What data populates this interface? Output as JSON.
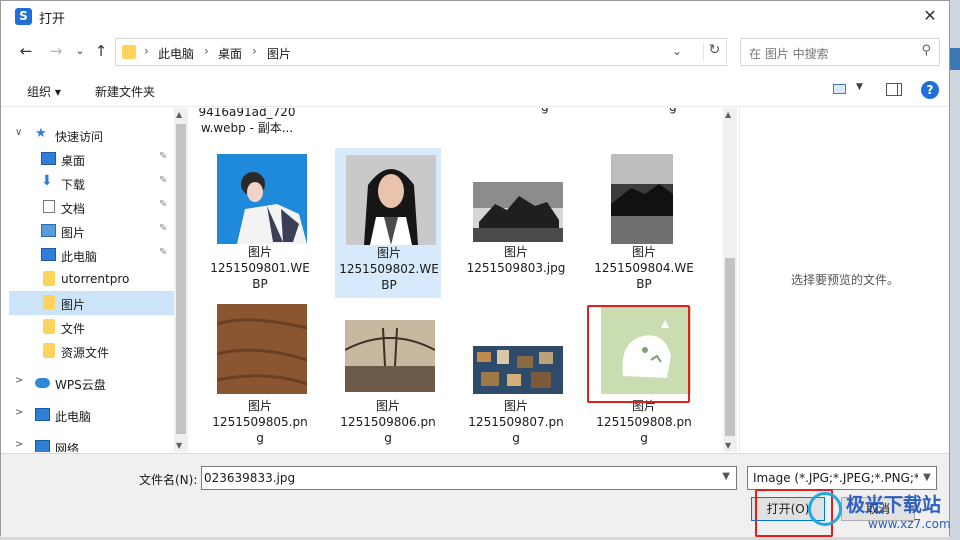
{
  "window": {
    "title": "打开",
    "app_icon_letter": "S",
    "close_glyph": "✕"
  },
  "nav": {
    "back": "←",
    "forward": "→",
    "recent": "⌄",
    "up": "↑",
    "breadcrumb": [
      "此电脑",
      "桌面",
      "图片"
    ],
    "sep": "›",
    "dropdown": "⌄",
    "refresh": "↻",
    "search_placeholder": "在 图片 中搜索",
    "search_icon": "⚲"
  },
  "toolbar": {
    "organize": "组织 ▾",
    "new_folder": "新建文件夹",
    "view_dropdown": "▼",
    "help": "?"
  },
  "sidebar": {
    "items": [
      {
        "label": "快速访问",
        "icon": "star-icon",
        "chev": "∨",
        "pin": ""
      },
      {
        "label": "桌面",
        "icon": "desktop-icon",
        "chev": "",
        "pin": "✎"
      },
      {
        "label": "下载",
        "icon": "download-icon",
        "chev": "",
        "pin": "✎"
      },
      {
        "label": "文档",
        "icon": "document-icon",
        "chev": "",
        "pin": "✎"
      },
      {
        "label": "图片",
        "icon": "pictures-icon",
        "chev": "",
        "pin": "✎"
      },
      {
        "label": "此电脑",
        "icon": "computer-icon",
        "chev": "",
        "pin": "✎"
      },
      {
        "label": "utorrentpro",
        "icon": "folder-icon",
        "chev": "",
        "pin": ""
      },
      {
        "label": "图片",
        "icon": "folder-icon",
        "chev": "",
        "pin": ""
      },
      {
        "label": "文件",
        "icon": "folder-icon",
        "chev": "",
        "pin": ""
      },
      {
        "label": "资源文件",
        "icon": "folder-icon",
        "chev": "",
        "pin": ""
      },
      {
        "label": "WPS云盘",
        "icon": "cloud-icon",
        "chev": ">",
        "pin": ""
      },
      {
        "label": "此电脑",
        "icon": "computer-icon",
        "chev": ">",
        "pin": ""
      },
      {
        "label": "网络",
        "icon": "network-icon",
        "chev": ">",
        "pin": ""
      }
    ]
  },
  "files": {
    "partial_top": {
      "line1": "9416a91ad_720",
      "line2": "w.webp - 副本..."
    },
    "partial_top_fragments": [
      "g",
      "g",
      "g"
    ],
    "tiles": [
      {
        "name": "图片 1251509801.WEBP",
        "line1": "图片",
        "line2": "1251509801.WE",
        "line3": "BP"
      },
      {
        "name": "图片 1251509802.WEBP",
        "line1": "图片",
        "line2": "1251509802.WE",
        "line3": "BP"
      },
      {
        "name": "图片 1251509803.jpg",
        "line1": "图片",
        "line2": "1251509803.jpg",
        "line3": ""
      },
      {
        "name": "图片 1251509804.WEBP",
        "line1": "图片",
        "line2": "1251509804.WE",
        "line3": "BP"
      },
      {
        "name": "图片 1251509805.png",
        "line1": "图片",
        "line2": "1251509805.pn",
        "line3": "g"
      },
      {
        "name": "图片 1251509806.png",
        "line1": "图片",
        "line2": "1251509806.pn",
        "line3": "g"
      },
      {
        "name": "图片 1251509807.png",
        "line1": "图片",
        "line2": "1251509807.pn",
        "line3": "g"
      },
      {
        "name": "图片 1251509808.png",
        "line1": "图片",
        "line2": "1251509808.pn",
        "line3": "g"
      }
    ]
  },
  "preview": {
    "message": "选择要预览的文件。"
  },
  "bottom": {
    "filename_label": "文件名(N):",
    "filename_value": "023639833.jpg",
    "filter_value": "Image (*.JPG;*.JPEG;*.PNG;*.B",
    "open_label": "打开(O)",
    "cancel_label": "取消"
  },
  "watermark": {
    "title": "极光下载站",
    "url": "www.xz7.com"
  },
  "colors": {
    "accent": "#0078d7",
    "selection": "#cce4f7",
    "highlight_box": "#e02020"
  }
}
